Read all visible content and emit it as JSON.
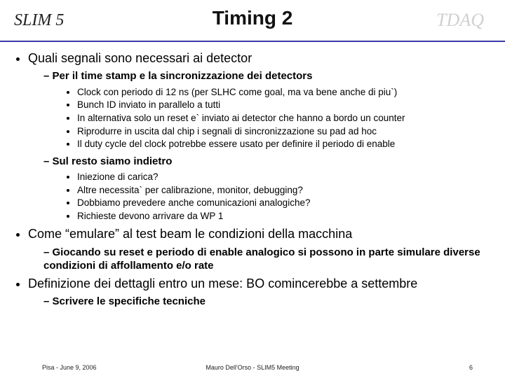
{
  "header": {
    "left": "SLIM 5",
    "center": "Timing 2",
    "right": "TDAQ"
  },
  "bullets": {
    "b1": "Quali segnali sono necessari ai detector",
    "b1_1": "Per il time stamp e la sincronizzazione dei detectors",
    "b1_1_1": "Clock con periodo di 12 ns (per SLHC come goal, ma va bene anche di piu`)",
    "b1_1_2": "Bunch ID inviato in parallelo a tutti",
    "b1_1_3": "In alternativa solo un reset e` inviato ai detector che hanno a bordo un counter",
    "b1_1_4": "Riprodurre in uscita dal chip i segnali di sincronizzazione su pad ad hoc",
    "b1_1_5": "Il duty cycle del clock potrebbe essere usato per definire il periodo di enable",
    "b1_2": "Sul resto siamo indietro",
    "b1_2_1": "Iniezione di carica?",
    "b1_2_2": "Altre necessita` per calibrazione, monitor, debugging?",
    "b1_2_3": "Dobbiamo prevedere anche comunicazioni analogiche?",
    "b1_2_4": "Richieste devono arrivare da WP 1",
    "b2": "Come “emulare” al test beam le condizioni della macchina",
    "b2_1": "Giocando su reset e periodo di enable analogico si possono in parte simulare diverse condizioni di affollamento e/o rate",
    "b3": "Definizione dei dettagli entro un mese: BO comincerebbe a settembre",
    "b3_1": "Scrivere le specifiche tecniche"
  },
  "footer": {
    "left": "Pisa - June 9, 2006",
    "center": "Mauro Dell'Orso - SLIM5 Meeting",
    "right": "6"
  }
}
